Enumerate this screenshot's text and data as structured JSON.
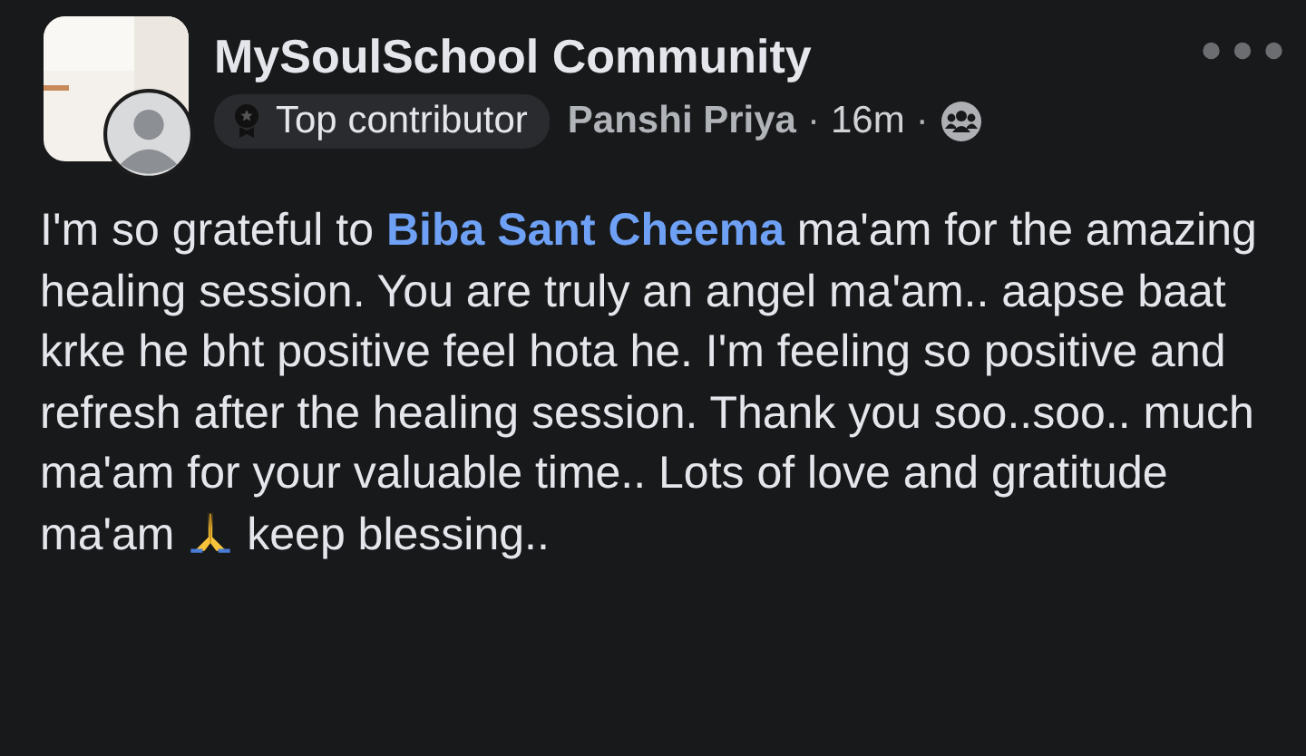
{
  "post": {
    "group_name": "MySoulSchool Community",
    "badge": "Top contributor",
    "author": "Panshi Priya",
    "time": "16m",
    "separator": "·",
    "text_before": "I'm so grateful to ",
    "mention": "Biba Sant Cheema",
    "text_after": " ma'am for the amazing healing session. You are truly an angel ma'am.. aapse baat krke he bht positive feel hota he. I'm feeling so positive and refresh after the healing session. Thank you soo..soo.. much ma'am for your valuable time.. Lots of love and gratitude ma'am",
    "text_end": " keep blessing.."
  }
}
